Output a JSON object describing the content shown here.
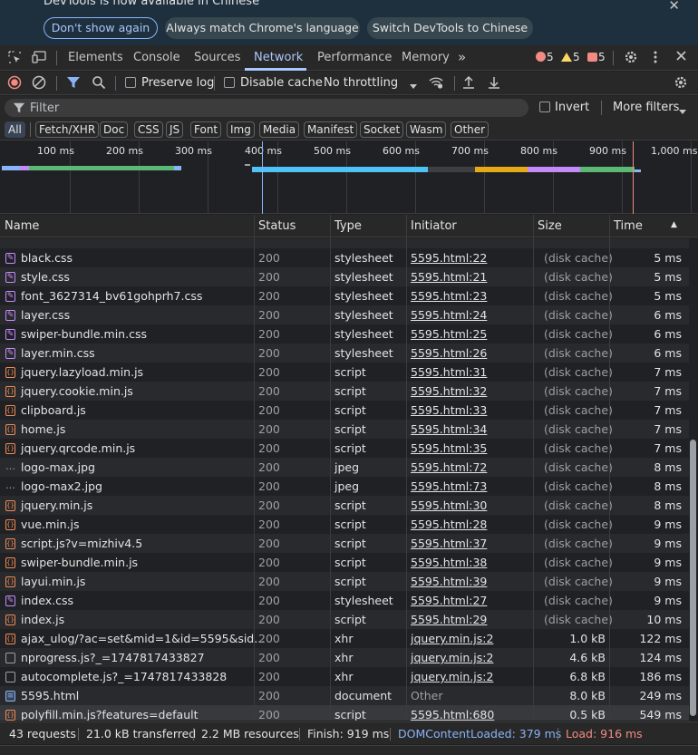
{
  "infobar": {
    "message": "DevTools is now available in Chinese",
    "dont_show": "Don't show again",
    "always_match": "Always match Chrome's language",
    "switch": "Switch DevTools to Chinese",
    "close": "✕"
  },
  "tabs": [
    "Elements",
    "Console",
    "Sources",
    "Network",
    "Performance",
    "Memory"
  ],
  "active_tab": "Network",
  "more_tabs": "»",
  "counts": {
    "errors": "5",
    "warnings": "5",
    "issues": "5"
  },
  "toolbar": {
    "preserve_log": "Preserve log",
    "disable_cache": "Disable cache",
    "throttling": "No throttling"
  },
  "filter": {
    "placeholder": "Filter",
    "invert": "Invert",
    "more_filters": "More filters"
  },
  "types": [
    "All",
    "Fetch/XHR",
    "Doc",
    "CSS",
    "JS",
    "Font",
    "Img",
    "Media",
    "Manifest",
    "Socket",
    "Wasm",
    "Other"
  ],
  "overview": {
    "ticks": [
      "100 ms",
      "200 ms",
      "300 ms",
      "400 ms",
      "500 ms",
      "600 ms",
      "700 ms",
      "800 ms",
      "900 ms",
      "1,000 ms"
    ]
  },
  "columns": {
    "name": "Name",
    "status": "Status",
    "type": "Type",
    "initiator": "Initiator",
    "size": "Size",
    "time": "Time",
    "sort_icon": "▲"
  },
  "rows": [
    {
      "name": "black.css",
      "status": "200",
      "type": "stylesheet",
      "initiator": "5595.html:22",
      "size": "(disk cache)",
      "time": "5 ms",
      "icon": "css"
    },
    {
      "name": "style.css",
      "status": "200",
      "type": "stylesheet",
      "initiator": "5595.html:21",
      "size": "(disk cache)",
      "time": "5 ms",
      "icon": "css"
    },
    {
      "name": "font_3627314_bv61gohprh7.css",
      "status": "200",
      "type": "stylesheet",
      "initiator": "5595.html:23",
      "size": "(disk cache)",
      "time": "5 ms",
      "icon": "css"
    },
    {
      "name": "layer.css",
      "status": "200",
      "type": "stylesheet",
      "initiator": "5595.html:24",
      "size": "(disk cache)",
      "time": "6 ms",
      "icon": "css"
    },
    {
      "name": "swiper-bundle.min.css",
      "status": "200",
      "type": "stylesheet",
      "initiator": "5595.html:25",
      "size": "(disk cache)",
      "time": "6 ms",
      "icon": "css"
    },
    {
      "name": "layer.min.css",
      "status": "200",
      "type": "stylesheet",
      "initiator": "5595.html:26",
      "size": "(disk cache)",
      "time": "6 ms",
      "icon": "css"
    },
    {
      "name": "jquery.lazyload.min.js",
      "status": "200",
      "type": "script",
      "initiator": "5595.html:31",
      "size": "(disk cache)",
      "time": "7 ms",
      "icon": "js"
    },
    {
      "name": "jquery.cookie.min.js",
      "status": "200",
      "type": "script",
      "initiator": "5595.html:32",
      "size": "(disk cache)",
      "time": "7 ms",
      "icon": "js"
    },
    {
      "name": "clipboard.js",
      "status": "200",
      "type": "script",
      "initiator": "5595.html:33",
      "size": "(disk cache)",
      "time": "7 ms",
      "icon": "js"
    },
    {
      "name": "home.js",
      "status": "200",
      "type": "script",
      "initiator": "5595.html:34",
      "size": "(disk cache)",
      "time": "7 ms",
      "icon": "js"
    },
    {
      "name": "jquery.qrcode.min.js",
      "status": "200",
      "type": "script",
      "initiator": "5595.html:35",
      "size": "(disk cache)",
      "time": "7 ms",
      "icon": "js"
    },
    {
      "name": "logo-max.jpg",
      "status": "200",
      "type": "jpeg",
      "initiator": "5595.html:72",
      "size": "(disk cache)",
      "time": "8 ms",
      "icon": "img"
    },
    {
      "name": "logo-max2.jpg",
      "status": "200",
      "type": "jpeg",
      "initiator": "5595.html:73",
      "size": "(disk cache)",
      "time": "8 ms",
      "icon": "img"
    },
    {
      "name": "jquery.min.js",
      "status": "200",
      "type": "script",
      "initiator": "5595.html:30",
      "size": "(disk cache)",
      "time": "8 ms",
      "icon": "js"
    },
    {
      "name": "vue.min.js",
      "status": "200",
      "type": "script",
      "initiator": "5595.html:28",
      "size": "(disk cache)",
      "time": "9 ms",
      "icon": "js"
    },
    {
      "name": "script.js?v=mizhiv4.5",
      "status": "200",
      "type": "script",
      "initiator": "5595.html:37",
      "size": "(disk cache)",
      "time": "9 ms",
      "icon": "js"
    },
    {
      "name": "swiper-bundle.min.js",
      "status": "200",
      "type": "script",
      "initiator": "5595.html:38",
      "size": "(disk cache)",
      "time": "9 ms",
      "icon": "js"
    },
    {
      "name": "layui.min.js",
      "status": "200",
      "type": "script",
      "initiator": "5595.html:39",
      "size": "(disk cache)",
      "time": "9 ms",
      "icon": "js"
    },
    {
      "name": "index.css",
      "status": "200",
      "type": "stylesheet",
      "initiator": "5595.html:27",
      "size": "(disk cache)",
      "time": "9 ms",
      "icon": "css"
    },
    {
      "name": "index.js",
      "status": "200",
      "type": "script",
      "initiator": "5595.html:29",
      "size": "(disk cache)",
      "time": "10 ms",
      "icon": "js"
    },
    {
      "name": "ajax_ulog/?ac=set&mid=1&id=5595&sid...",
      "status": "200",
      "type": "xhr",
      "initiator": "jquery.min.js:2",
      "size": "1.0 kB",
      "time": "122 ms",
      "icon": "xhr"
    },
    {
      "name": "nprogress.js?_=1747817433827",
      "status": "200",
      "type": "xhr",
      "initiator": "jquery.min.js:2",
      "size": "4.6 kB",
      "time": "124 ms",
      "icon": "doc"
    },
    {
      "name": "autocomplete.js?_=1747817433828",
      "status": "200",
      "type": "xhr",
      "initiator": "jquery.min.js:2",
      "size": "6.8 kB",
      "time": "186 ms",
      "icon": "doc"
    },
    {
      "name": "5595.html",
      "status": "200",
      "type": "document",
      "initiator": "Other",
      "size": "8.0 kB",
      "time": "249 ms",
      "icon": "html"
    },
    {
      "name": "polyfill.min.js?features=default",
      "status": "200",
      "type": "script",
      "initiator": "5595.html:680",
      "size": "0.5 kB",
      "time": "549 ms",
      "icon": "js"
    }
  ],
  "status_bar": {
    "requests": "43 requests",
    "transferred": "21.0 kB transferred",
    "resources": "2.2 MB resources",
    "finish": "Finish: 919 ms",
    "dcl": "DOMContentLoaded: 379 ms",
    "load": "Load: 916 ms"
  },
  "colors": {
    "accent": "#a8c7fa",
    "dcl": "#8ab4f8",
    "load": "#f28b82",
    "error": "#f28b82",
    "warning": "#fdd663"
  }
}
